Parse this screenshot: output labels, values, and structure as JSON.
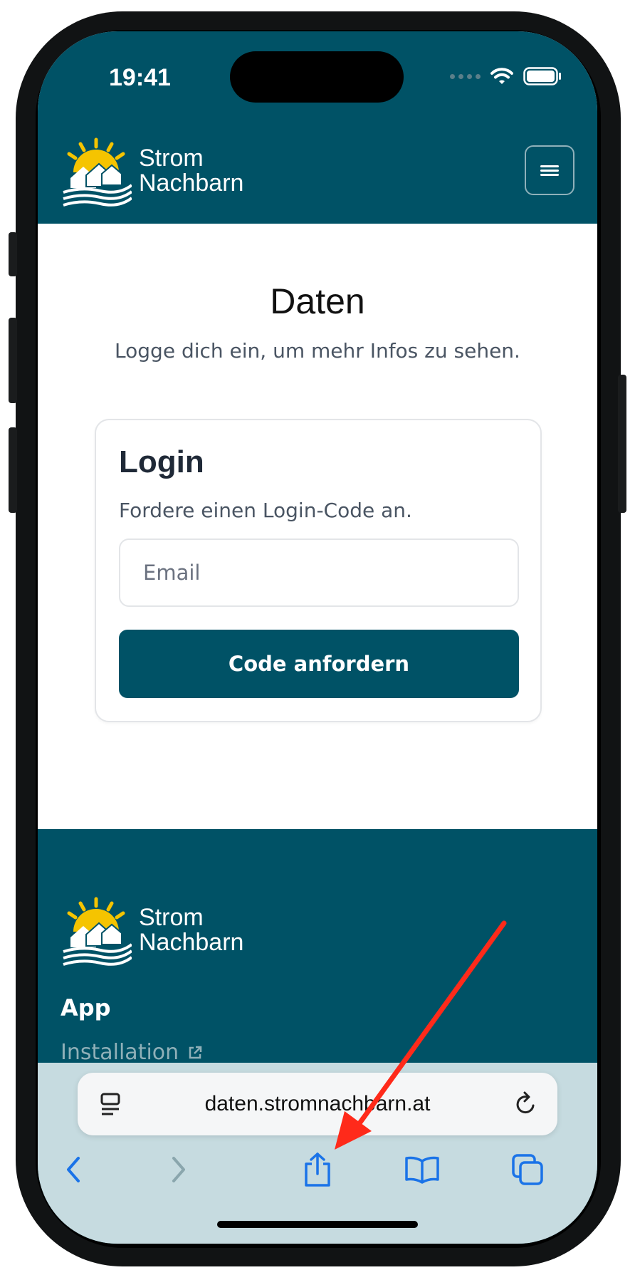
{
  "status": {
    "time": "19:41"
  },
  "brand": {
    "line1": "Strom",
    "line2": "Nachbarn"
  },
  "main": {
    "title": "Daten",
    "subtitle": "Logge dich ein, um mehr Infos zu sehen."
  },
  "login": {
    "title": "Login",
    "subtitle": "Fordere einen Login-Code an.",
    "email_placeholder": "Email",
    "email_value": "",
    "submit_label": "Code anfordern"
  },
  "footer": {
    "heading": "App",
    "link_label": "Installation"
  },
  "browser": {
    "url": "daten.stromnachbarn.at"
  },
  "colors": {
    "brand_teal": "#005266",
    "sun_yellow": "#f5c400",
    "annotation_red": "#ff2a1a",
    "ios_blue": "#1a73e8"
  },
  "icons": [
    "menu-icon",
    "reader-icon",
    "reload-icon",
    "back-icon",
    "forward-icon",
    "share-icon",
    "bookmarks-icon",
    "tabs-icon",
    "external-link-icon",
    "wifi-icon",
    "battery-icon"
  ]
}
